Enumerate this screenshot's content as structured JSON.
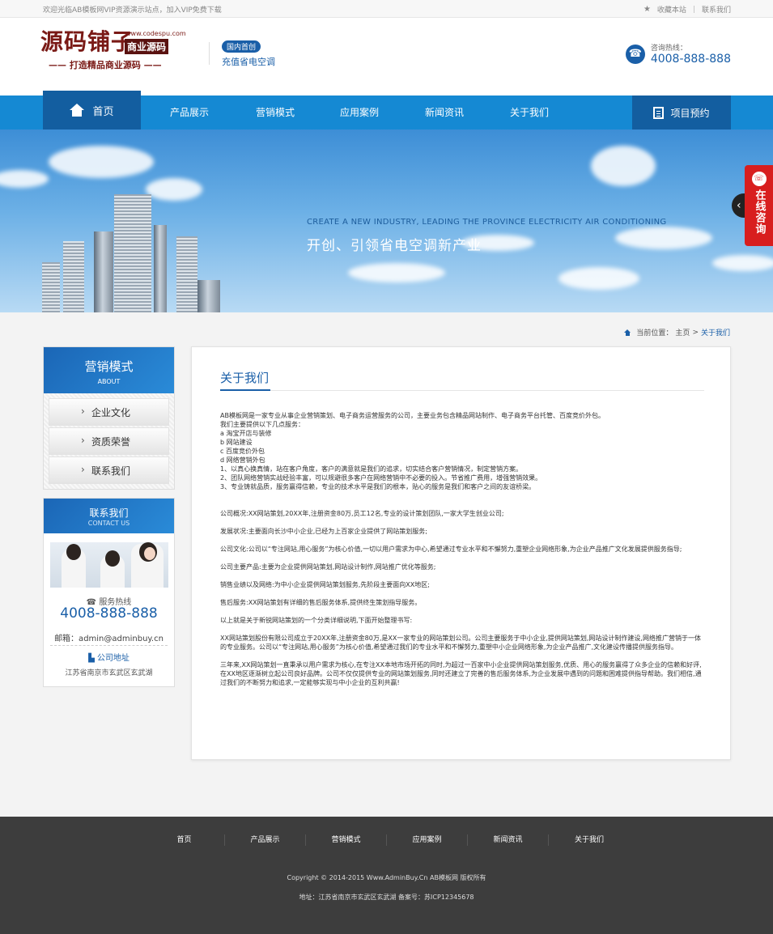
{
  "topbar": {
    "welcome": "欢迎光临AB模板网VIP资源演示站点，加入VIP免费下载",
    "bookmark": "收藏本站",
    "separator": "|",
    "contact": "联系我们"
  },
  "header": {
    "logo_main": "源码铺子",
    "logo_url": "www.codespu.com",
    "logo_badge": "商业源码",
    "logo_slogan": "—— 打造精品商业源码 ——",
    "tag_pill": "国内首创",
    "tag_text": "充值省电空调",
    "hotline_label": "咨询热线：",
    "hotline_number": "4008-888-888"
  },
  "nav": {
    "home": "首页",
    "items": [
      "产品展示",
      "营销模式",
      "应用案例",
      "新闻资讯",
      "关于我们"
    ],
    "reserve": "项目预约"
  },
  "banner": {
    "en": "CREATE A NEW INDUSTRY, LEADING THE PROVINCE ELECTRICITY AIR CONDITIONING",
    "cn": "开创、引领省电空调新产业",
    "arrow": "‹"
  },
  "online": {
    "text": "在线咨询"
  },
  "breadcrumb": {
    "label": "当前位置：",
    "home": "主页",
    "sep": ">",
    "current": "关于我们"
  },
  "sidebar": {
    "title": "营销模式",
    "subtitle": "ABOUT",
    "items": [
      "企业文化",
      "资质荣誉",
      "联系我们"
    ]
  },
  "contact_box": {
    "title": "联系我们",
    "subtitle": "CONTACT US",
    "service_label": "服务热线",
    "phone": "4008-888-888",
    "email": "邮箱：admin@adminbuy.cn",
    "address_label": "公司地址",
    "address": "江苏省南京市玄武区玄武湖"
  },
  "article": {
    "title": "关于我们",
    "lines": [
      "AB模板网是一家专业从事企业营销策划、电子商务运营服务的公司，主要业务包含精品网站制作、电子商务平台托管、百度竞价外包。",
      "我们主要提供以下几点服务：",
      "a  淘宝开店与装修",
      "b  网站建设",
      "c  百度竞价外包",
      "d  网络营销外包",
      "1、以真心换真情，站在客户角度，客户的满意就是我们的追求，切实结合客户营销情况，制定营销方案。",
      "2、团队网络营销实战经验丰富，可以规避很多客户在网络营销中不必要的投入。节省推广费用，增强营销效果。",
      "3、专业铸就品质，服务赢得信赖，专业的技术水平是我们的根本，贴心的服务是我们和客户之间的友谊桥梁。"
    ],
    "paragraphs": [
      "公司概况:XX网站策划,20XX年,注册资金80万,员工12名,专业的设计策划团队,一家大学生创业公司;",
      "发展状况:主要面向长沙中小企业,已经为上百家企业提供了网站策划服务;",
      "公司文化:公司以“专注网站,用心服务”为核心价值,一切以用户需求为中心,希望通过专业水平和不懈努力,重塑企业网络形象,为企业产品推广文化发展提供服务指导;",
      "公司主要产品:主要为企业提供网站策划,网站设计制作,网站推广优化等服务;",
      "销售业绩以及网络:为中小企业提供网站策划服务,先阶段主要面向XX地区;",
      "售后服务:XX网站策划有详细的售后服务体系,提供终生策划指导服务。",
      "以上就是关于新锐网站策划的一个分类详细说明,下面开始整理书写:",
      "XX网站策划股份有限公司成立于20XX年,注册资金80万,是XX一家专业的网站策划公司。公司主要服务于中小企业,提供网站策划,网站设计制作建设,网络推广营销于一体的专业服务。公司以“专注网站,用心服务”为核心价值,希望通过我们的专业水平和不懈努力,重塑中小企业网络形象,为企业产品推广,文化建设传播提供服务指导。",
      "三年来,XX网站策划一直秉承以用户需求为核心,在专注XX本地市场开拓的同时,为超过一百家中小企业提供网站策划服务,优质、用心的服务赢得了众多企业的信赖和好评,在XX地区逐渐树立起公司良好品牌。公司不仅仅提供专业的网站策划服务,同时还建立了完善的售后服务体系,为企业发展中遇到的问题和困难提供指导帮助。我们相信,通过我们的不断努力和追求,一定能够实现与中小企业的互利共赢!"
    ]
  },
  "footer": {
    "nav": [
      "首页",
      "产品展示",
      "营销模式",
      "应用案例",
      "新闻资讯",
      "关于我们"
    ],
    "copyright": "Copyright © 2014-2015 Www.AdminBuy.Cn AB模板网 版权所有",
    "address": "地址：江苏省南京市玄武区玄武湖      备案号：苏ICP12345678"
  },
  "colors": {
    "brand_blue": "#1a5fa8",
    "nav_blue": "#1589d3",
    "logo_red": "#7a1a16",
    "online_red": "#d81e1e",
    "footer_bg": "#3d3d3d"
  }
}
